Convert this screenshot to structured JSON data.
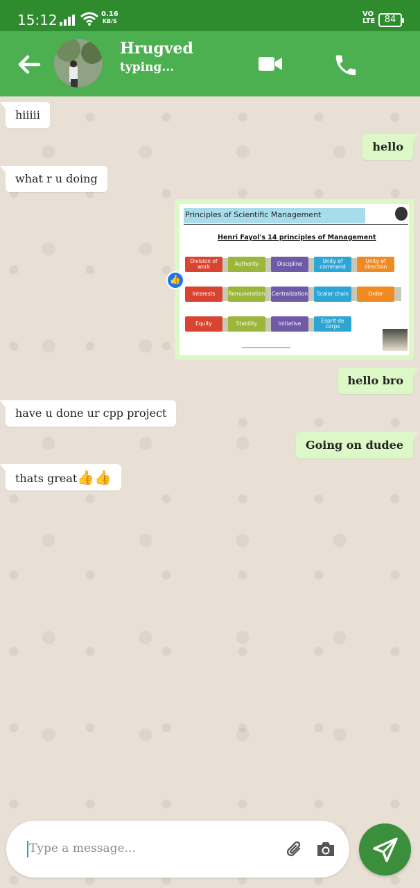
{
  "status_bar": {
    "time": "15:12",
    "net_speed_value": "0.16",
    "net_speed_unit": "KB/S",
    "volte_line1": "VO",
    "volte_line2": "LTE",
    "battery": "84",
    "icons": [
      "signal-icon",
      "wifi-icon",
      "battery-icon"
    ]
  },
  "header": {
    "contact_name": "Hrugved",
    "contact_status": "typing...",
    "icons": [
      "back-arrow-icon",
      "video-call-icon",
      "phone-icon"
    ],
    "color": "#4caf50"
  },
  "messages": [
    {
      "direction": "incoming",
      "text": "hiiiii"
    },
    {
      "direction": "outgoing",
      "text": "hello"
    },
    {
      "direction": "incoming",
      "text": "what r u doing"
    },
    {
      "direction": "outgoing",
      "type": "image",
      "image": {
        "slide_title": "Principles of  Scientific Management",
        "slide_subtitle": "Henri Fayol's 14 principles of Management",
        "row1": [
          "Division of work",
          "Authority",
          "Discipline",
          "Unity of command",
          "Unity of direction"
        ],
        "row2": [
          "Interests",
          "Remuneration",
          "Centralization",
          "Scalar chain",
          "Order"
        ],
        "row3": [
          "Equity",
          "Stability",
          "Initiative",
          "Esprit de corps"
        ]
      },
      "reaction_icon": "thumbs-up-icon"
    },
    {
      "direction": "outgoing",
      "text": "hello bro"
    },
    {
      "direction": "incoming",
      "text": "have u done ur cpp project"
    },
    {
      "direction": "outgoing",
      "text": "Going on dudee"
    },
    {
      "direction": "incoming",
      "text": "thats great",
      "emoji": "👍👍"
    }
  ],
  "composer": {
    "placeholder": "Type a message...",
    "icons": [
      "attach-icon",
      "camera-icon",
      "send-icon"
    ]
  },
  "colors": {
    "status_bar": "#2e8b2e",
    "outgoing_bubble": "#dcf8c6",
    "incoming_bubble": "#ffffff",
    "send_button": "#3b8e3b"
  }
}
